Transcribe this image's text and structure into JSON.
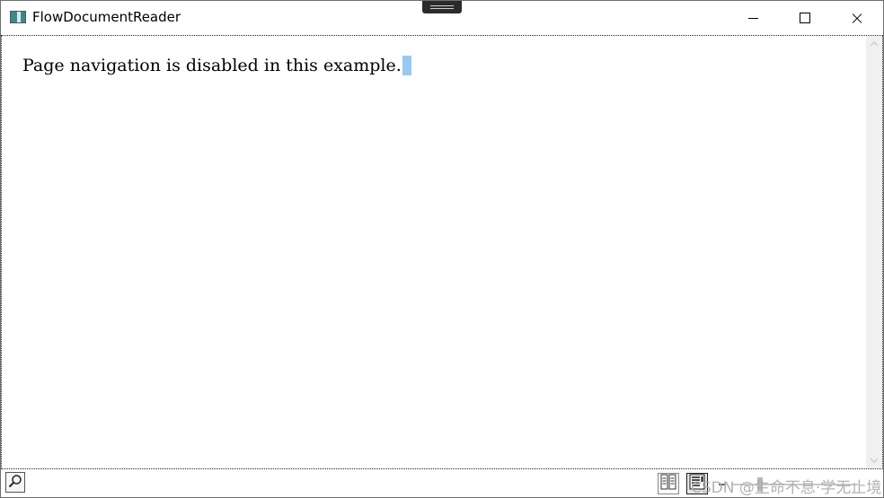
{
  "window": {
    "title": "FlowDocumentReader",
    "icon": "app-window-icon"
  },
  "caption_buttons": {
    "minimize_icon": "minimize-icon",
    "maximize_icon": "maximize-icon",
    "close_icon": "close-icon"
  },
  "document": {
    "text": "Page navigation is disabled in this example.",
    "caret_highlight_color": "#99c9ef"
  },
  "toolbar": {
    "find_icon": "magnifier-icon",
    "view_modes": [
      "two-page-view-icon",
      "scroll-view-icon"
    ],
    "selected_view_mode": "scroll-view-icon",
    "zoom_out_icon": "zoom-out-icon",
    "watermark": "CSDN @生命不息·学无止境"
  },
  "colors": {
    "window_border": "#6e6e6e",
    "scrollbar_track": "#f0f0f0"
  }
}
